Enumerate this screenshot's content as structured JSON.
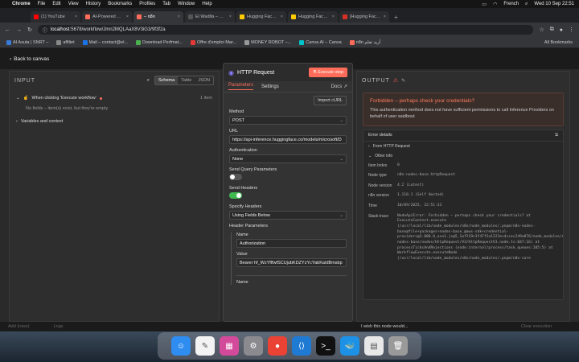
{
  "menubar": {
    "app": "Chrome",
    "items": [
      "File",
      "Edit",
      "View",
      "History",
      "Bookmarks",
      "Profiles",
      "Tab",
      "Window",
      "Help"
    ],
    "input_source": "French",
    "datetime": "Wed 10 Sep  22:51"
  },
  "tabs": [
    {
      "label": "(1) YouTube",
      "color": "#ff0000",
      "active": false
    },
    {
      "label": "AI-Powered WordPress",
      "color": "#ff6d5a",
      "active": false
    },
    {
      "label": "– n8n",
      "color": "#ff6d5a",
      "active": true
    },
    {
      "label": "El Wadifa – مسابقات –",
      "color": "#555555",
      "active": false
    },
    {
      "label": "Hugging Face – The AI",
      "color": "#ffcc00",
      "active": false
    },
    {
      "label": "Hugging Face – The AI",
      "color": "#ffcc00",
      "active": false
    },
    {
      "label": "[Hugging Face] Click th",
      "color": "#d93025",
      "active": false
    }
  ],
  "address": {
    "host": "localhost",
    "path": ":5678/workflow/Jmn2MQLAaX8V3iG3/9f3f2a"
  },
  "bookmarks": {
    "items": [
      {
        "label": "AI Asuta | SNRT –",
        "color": "#3a7bd5"
      },
      {
        "label": "affiliet",
        "color": "#888888"
      },
      {
        "label": "Mail – contact@el...",
        "color": "#1a73e8"
      },
      {
        "label": "Download Perfmat...",
        "color": "#4caf50"
      },
      {
        "label": "Offre d'emploi Mar...",
        "color": "#e53935"
      },
      {
        "label": "MONEY ROBOT –...",
        "color": "#999999"
      },
      {
        "label": "Canva AI – Canva",
        "color": "#00c4cc"
      },
      {
        "label": "n8n أريد تعلم",
        "color": "#ff6d5a"
      }
    ],
    "all": "All Bookmarks"
  },
  "app": {
    "back_label": "Back to canvas",
    "input": {
      "title": "INPUT",
      "views": [
        "Schema",
        "Table",
        "JSON"
      ],
      "active_view": "Schema",
      "trigger_label": "When clicking 'Execute workflow'",
      "items_count": "1 item",
      "empty_msg": "No fields – item(s) exist, but they're empty",
      "vars_label": "Variables and context"
    },
    "node": {
      "title": "HTTP Request",
      "execute_label": "Execute step",
      "tab_parameters": "Parameters",
      "tab_settings": "Settings",
      "docs_label": "Docs",
      "import_label": "Import cURL",
      "method_label": "Method",
      "method_value": "POST",
      "url_label": "URL",
      "url_value": "https://api-inference.huggingface.co/models/microsoft/D",
      "auth_label": "Authentication",
      "auth_value": "None",
      "query_label": "Send Query Parameters",
      "headers_label": "Send Headers",
      "specify_label": "Specify Headers",
      "specify_value": "Using Fields Below",
      "header_params_label": "Header Parameters",
      "name_label": "Name",
      "name_value": "Authorization",
      "value_label": "Value",
      "value_value": "Bearer hf_WzYflfwfSCUjubKDZYzYcYabKaIdBmsbp",
      "name2_label": "Name"
    },
    "output": {
      "title": "OUTPUT",
      "error_title": "Forbidden – perhaps check your credentials?",
      "error_desc": "This authentication method does not have sufficient permissions to call Inference Providers on behalf of user saidbout",
      "details_label": "Error details",
      "from_label": "From HTTP Request",
      "other_label": "Other info",
      "rows": [
        {
          "k": "Item Index",
          "v": "0"
        },
        {
          "k": "Node type",
          "v": "n8n-nodes-base.httpRequest"
        },
        {
          "k": "Node version",
          "v": "4.2 (Latest)"
        },
        {
          "k": "n8n version",
          "v": "1.110.1 (Self Hosted)"
        },
        {
          "k": "Time",
          "v": "10/09/2025, 22:51:33"
        }
      ],
      "stack_label": "Stack trace",
      "stack_value": "NodeApiError: Forbidden – perhaps check your credentials? at ExecuteContext.execute (/usr/local/lib/node_modules/n8n/node_modules/.pnpm/n8n-nodes-base@file+packages+nodes-base_@aws-sdk+credential-providers@3.808.0_asn1.js@5_1af219c3f47f2a1223ec4ccec249a876/node_modules/n8n-nodes-base/nodes/HttpRequest/V3/HttpRequestV3.node.ts:847:16) at processTicksAndRejections (node:internal/process/task_queues:105:5) at WorkflowExecute.executeNode (/usr/local/lib/node_modules/n8n/node_modules/.pnpm/n8n-core"
    },
    "bottom": {
      "left": "Add (rows)",
      "logs": "Logs",
      "wish": "I wish this node would...",
      "right": "Clear execution"
    }
  },
  "dock": [
    {
      "name": "finder",
      "glyph": "☺",
      "color": "#2f8cf0"
    },
    {
      "name": "notes",
      "glyph": "✎",
      "color": "#f3f3f3"
    },
    {
      "name": "launchpad",
      "glyph": "▦",
      "color": "#d44a9b"
    },
    {
      "name": "settings",
      "glyph": "⚙",
      "color": "#8a8a8f"
    },
    {
      "name": "chrome",
      "glyph": "●",
      "color": "#ea4335"
    },
    {
      "name": "vscode",
      "glyph": "⟨⟩",
      "color": "#1f7ad4"
    },
    {
      "name": "terminal",
      "glyph": ">_",
      "color": "#111111"
    },
    {
      "name": "docker",
      "glyph": "🐳",
      "color": "#1d91e6"
    },
    {
      "name": "document",
      "glyph": "▤",
      "color": "#e8e8e8"
    },
    {
      "name": "trash",
      "glyph": "🗑",
      "color": "#9a9a9a"
    }
  ]
}
